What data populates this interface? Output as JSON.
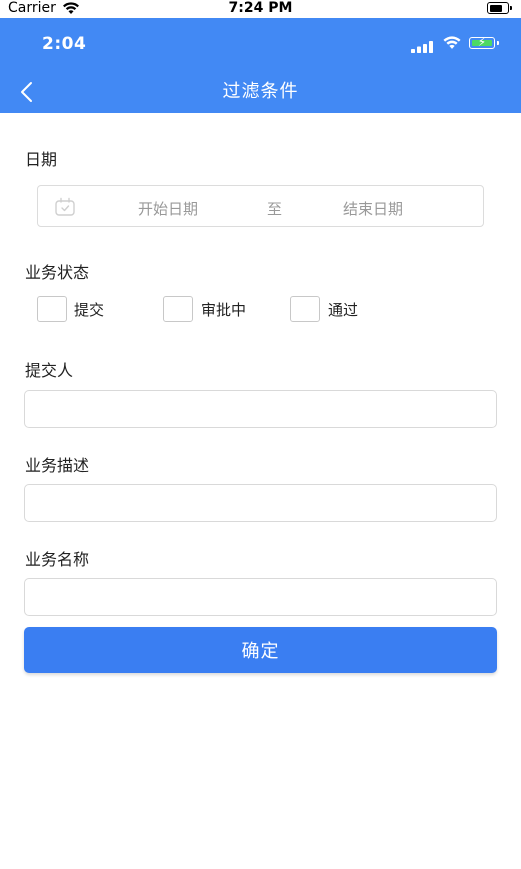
{
  "device_status": {
    "carrier": "Carrier",
    "time": "7:24 PM"
  },
  "app_status": {
    "time": "2:04"
  },
  "nav": {
    "title": "过滤条件",
    "back_icon": "chevron-left-icon"
  },
  "form": {
    "date": {
      "label": "日期",
      "start_placeholder": "开始日期",
      "separator": "至",
      "end_placeholder": "结束日期",
      "icon": "calendar-icon"
    },
    "status": {
      "label": "业务状态",
      "options": [
        {
          "label": "提交",
          "checked": false
        },
        {
          "label": "审批中",
          "checked": false
        },
        {
          "label": "通过",
          "checked": false
        }
      ]
    },
    "submitter": {
      "label": "提交人",
      "value": "",
      "placeholder": ""
    },
    "description": {
      "label": "业务描述",
      "value": "",
      "placeholder": ""
    },
    "name": {
      "label": "业务名称",
      "value": "",
      "placeholder": ""
    },
    "confirm_label": "确定"
  },
  "colors": {
    "header": "#4289f4",
    "button": "#3a7ef2",
    "battery_fill": "#4cd964"
  }
}
